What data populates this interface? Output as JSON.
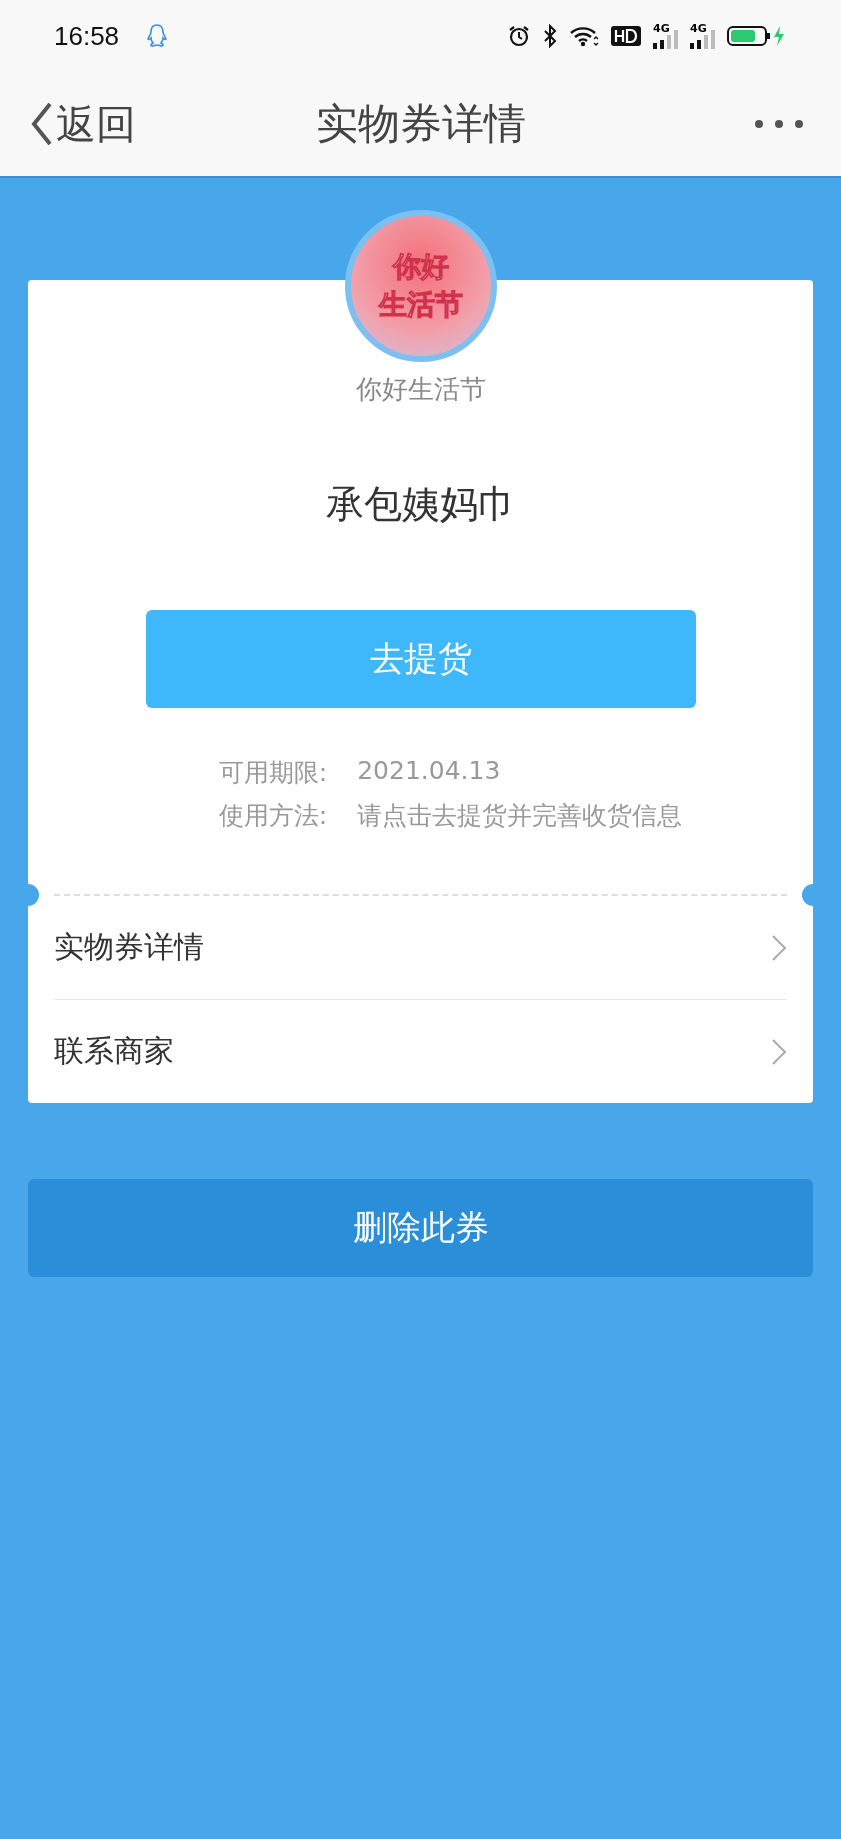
{
  "status_bar": {
    "time": "16:58",
    "network_1": "4G",
    "network_2": "4G"
  },
  "nav": {
    "back_label": "返回",
    "title": "实物券详情"
  },
  "coupon": {
    "logo_lines": [
      "你好",
      "生活节"
    ],
    "merchant": "你好生活节",
    "name": "承包姨妈巾",
    "action": "去提货",
    "info": [
      {
        "label": "可用期限:",
        "value": "2021.04.13"
      },
      {
        "label": "使用方法:",
        "value": "请点击去提货并完善收货信息"
      }
    ],
    "links": [
      {
        "label": "实物券详情"
      },
      {
        "label": "联系商家"
      }
    ]
  },
  "delete_button": "删除此券"
}
